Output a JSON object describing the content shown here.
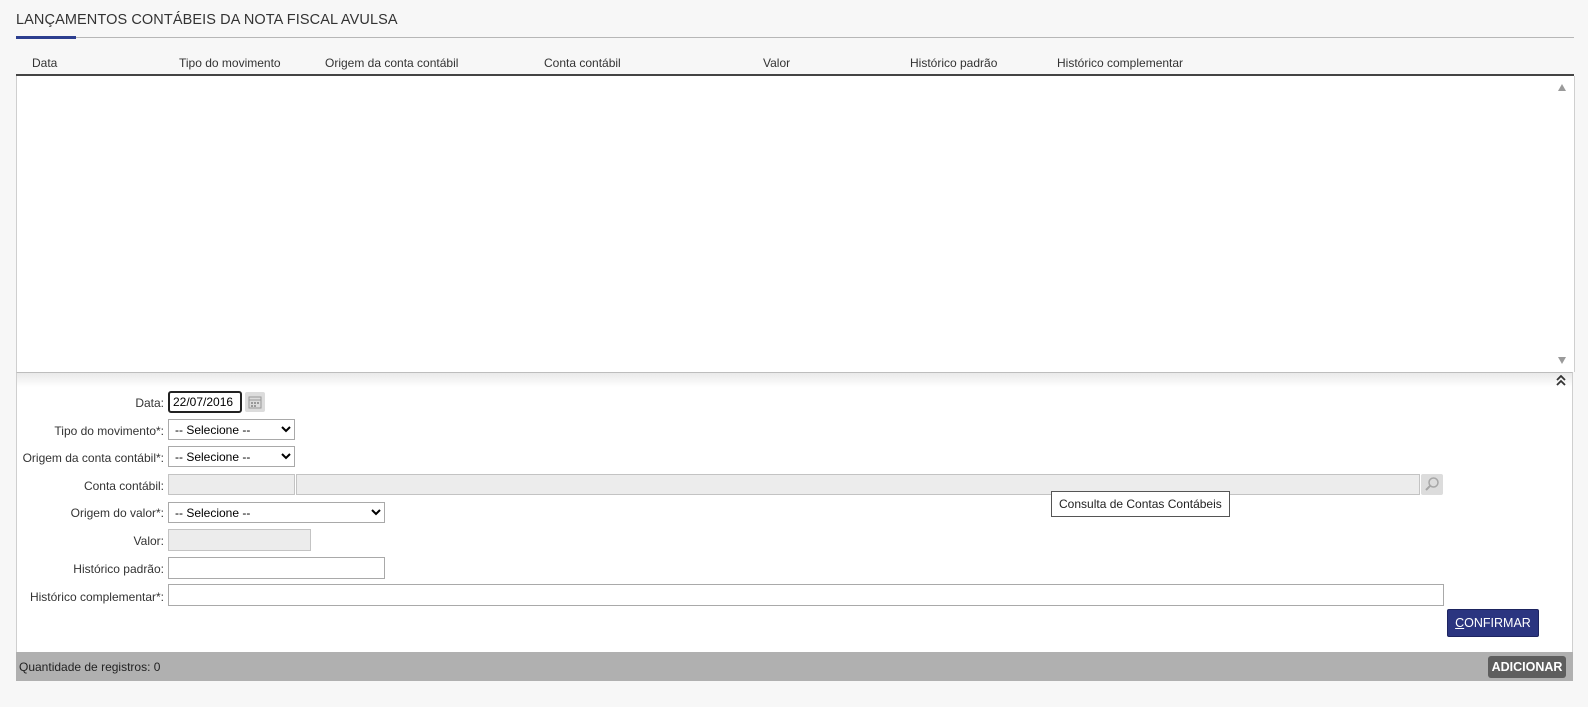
{
  "section": {
    "title": "LANÇAMENTOS CONTÁBEIS DA NOTA FISCAL AVULSA"
  },
  "grid": {
    "columns": [
      "Data",
      "Tipo do movimento",
      "Origem da conta contábil",
      "Conta contábil",
      "Valor",
      "Histórico padrão",
      "Histórico complementar"
    ],
    "rows": []
  },
  "form": {
    "data_label": "Data:",
    "data_value": "22/07/2016",
    "tipo_label": "Tipo do movimento*:",
    "tipo_selected": "-- Selecione --",
    "origem_conta_label": "Origem da conta contábil*:",
    "origem_conta_selected": "-- Selecione --",
    "conta_label": "Conta contábil:",
    "conta_code": "",
    "conta_desc": "",
    "origem_valor_label": "Origem do valor*:",
    "origem_valor_selected": "-- Selecione --",
    "valor_label": "Valor:",
    "valor_value": "",
    "hist_padrao_label": "Histórico padrão:",
    "hist_padrao_value": "",
    "hist_comp_label": "Histórico complementar*:",
    "hist_comp_value": "",
    "tooltip": "Consulta de Contas Contábeis",
    "confirm_first": "C",
    "confirm_rest": "ONFIRMAR"
  },
  "footer": {
    "count_text": "Quantidade de registros: 0",
    "add_label": "ADICIONAR"
  },
  "icons": {
    "calendar": "calendar-icon",
    "search": "search-icon",
    "collapse": "double-chevron-up-icon",
    "scroll_up": "scroll-up-arrow",
    "scroll_down": "scroll-down-arrow"
  },
  "colors": {
    "accent": "#2c3e8f",
    "confirm_button": "#2b3580",
    "add_button": "#5e5e5e",
    "footer_bar": "#b0b0b0"
  }
}
